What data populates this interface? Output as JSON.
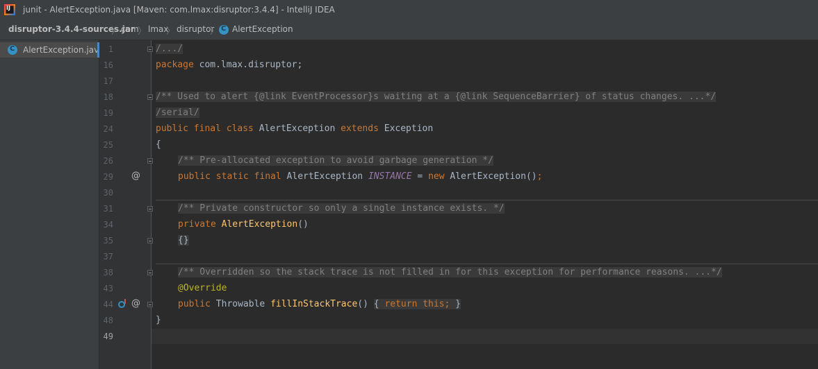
{
  "window": {
    "title": "junit - AlertException.java [Maven: com.lmax:disruptor:3.4.4] - IntelliJ IDEA"
  },
  "breadcrumbs": {
    "jar": "disruptor-3.4.4-sources.jar",
    "pkg1": "com",
    "pkg2": "lmax",
    "pkg3": "disruptor",
    "cls": "AlertException",
    "sep": "〉"
  },
  "project": {
    "file": "AlertException.java"
  },
  "code": {
    "l1": {
      "num": "1",
      "t": "/.../"
    },
    "l16": {
      "num": "16",
      "a": "package",
      "b": " com.lmax.disruptor;"
    },
    "l17": {
      "num": "17"
    },
    "l18": {
      "num": "18",
      "t": "/** Used to alert {@link EventProcessor}s waiting at a {@link SequenceBarrier} of status changes. ...*/"
    },
    "l19": {
      "num": "19",
      "t": "/serial/"
    },
    "l24": {
      "num": "24",
      "a": "public final class",
      "b": " AlertException ",
      "c": "extends",
      "d": " Exception"
    },
    "l25": {
      "num": "25",
      "t": "{"
    },
    "l26": {
      "num": "26",
      "t": "/** Pre-allocated exception to avoid garbage generation */"
    },
    "l29": {
      "num": "29",
      "a": "public static final",
      "b": " AlertException ",
      "c": "INSTANCE",
      "d": " = ",
      "e": "new",
      "f": " AlertException()",
      "g": ";"
    },
    "l30": {
      "num": "30"
    },
    "l31": {
      "num": "31",
      "t": "/** Private constructor so only a single instance exists. */"
    },
    "l34": {
      "num": "34",
      "a": "private",
      "b": "AlertException",
      "c": "()"
    },
    "l35": {
      "num": "35",
      "t": "{}"
    },
    "l37": {
      "num": "37"
    },
    "l38": {
      "num": "38",
      "t": "/** Overridden so the stack trace is not filled in for this exception for performance reasons. ...*/"
    },
    "l43": {
      "num": "43",
      "t": "@Override"
    },
    "l44": {
      "num": "44",
      "a": "public",
      "b": " Throwable ",
      "c": "fillInStackTrace",
      "d": "()",
      "e": "{ ",
      "f": "return this;",
      "g": " }"
    },
    "l48": {
      "num": "48",
      "t": "}"
    },
    "l49": {
      "num": "49"
    }
  },
  "gutter": {
    "at": "@"
  },
  "colors": {
    "keyword": "#cc7832",
    "comment": "#808080",
    "field": "#9876aa",
    "method": "#ffc66d",
    "annotation": "#bbb529",
    "text": "#a9b7c6"
  },
  "icons": [
    "intellij-icon",
    "class-icon",
    "fold-icon",
    "override-icon",
    "implemented-icon"
  ]
}
